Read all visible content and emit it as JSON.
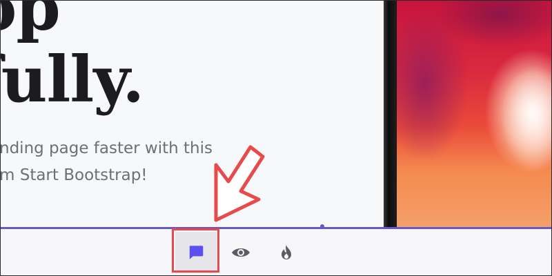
{
  "hero": {
    "heading_lines": "op\nfully.",
    "lead_text": "nding page faster with this\nm Start Bootstrap!"
  },
  "tabbar": {
    "tabs": [
      {
        "icon": "chat-bubble-icon",
        "selected": true
      },
      {
        "icon": "eye-icon",
        "selected": false
      },
      {
        "icon": "fire-icon",
        "selected": false
      }
    ],
    "accent_color": "#6758c7",
    "icon_color": "#5a5d66"
  },
  "annotation": {
    "color": "#e74a4a",
    "target": "chat-bubble-icon"
  }
}
